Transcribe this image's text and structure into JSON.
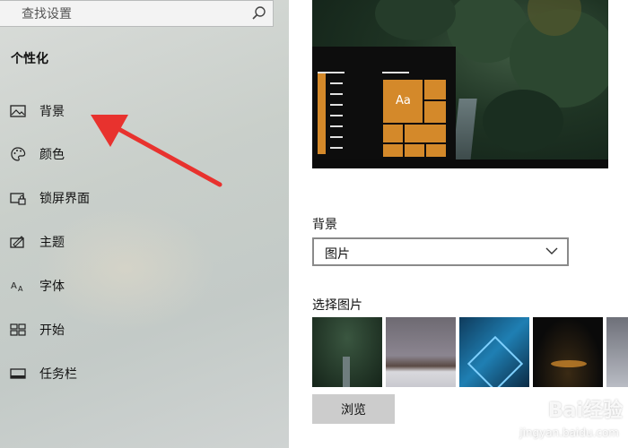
{
  "search": {
    "placeholder": "查找设置"
  },
  "sidebar": {
    "section_title": "个性化",
    "items": [
      {
        "label": "背景",
        "icon": "picture-icon"
      },
      {
        "label": "颜色",
        "icon": "palette-icon"
      },
      {
        "label": "锁屏界面",
        "icon": "lock-screen-icon"
      },
      {
        "label": "主题",
        "icon": "theme-icon"
      },
      {
        "label": "字体",
        "icon": "font-icon"
      },
      {
        "label": "开始",
        "icon": "start-icon"
      },
      {
        "label": "任务栏",
        "icon": "taskbar-icon"
      }
    ]
  },
  "main": {
    "preview_tile_text": "Aa",
    "background_label": "背景",
    "background_value": "图片",
    "choose_picture_label": "选择图片",
    "browse_label": "浏览"
  },
  "colors": {
    "accent": "#d4892a",
    "arrow": "#e8322e"
  },
  "watermark": {
    "brand": "Bai经验",
    "url": "jingyan.baidu.com"
  }
}
